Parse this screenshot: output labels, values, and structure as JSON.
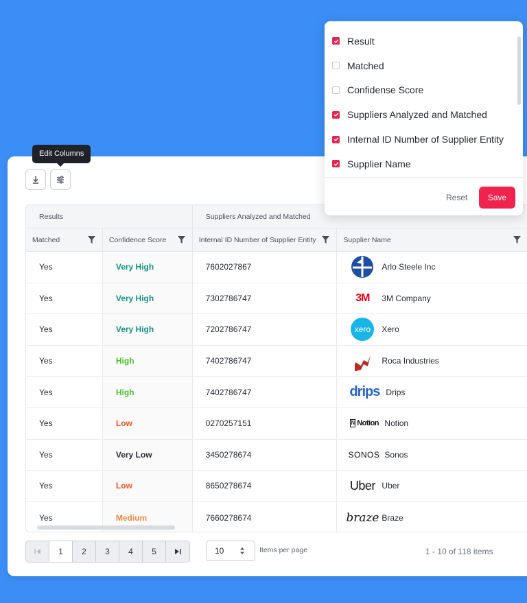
{
  "toolbar": {
    "tooltip": "Edit Columns"
  },
  "table": {
    "groups": [
      "Results",
      "Suppliers Analyzed and Matched"
    ],
    "columns": [
      "Matched",
      "Confidence Score",
      "Internal ID Number of Supplier Entity",
      "Supplier Name"
    ],
    "rows": [
      {
        "matched": "Yes",
        "confidence": "Very High",
        "conf_color": "#12917f",
        "id": "7602027867",
        "supplier": "Arlo Steele Inc",
        "logo": "arlo-steele-logo"
      },
      {
        "matched": "Yes",
        "confidence": "Very High",
        "conf_color": "#12917f",
        "id": "7302786747",
        "supplier": "3M Company",
        "logo": "3m-logo"
      },
      {
        "matched": "Yes",
        "confidence": "Very High",
        "conf_color": "#12917f",
        "id": "7202786747",
        "supplier": "Xero",
        "logo": "xero-logo"
      },
      {
        "matched": "Yes",
        "confidence": "High",
        "conf_color": "#4cc22a",
        "id": "7402786747",
        "supplier": "Roca Industries",
        "logo": "roca-logo"
      },
      {
        "matched": "Yes",
        "confidence": "High",
        "conf_color": "#4cc22a",
        "id": "7402786747",
        "supplier": "Drips",
        "logo": "drips-logo"
      },
      {
        "matched": "Yes",
        "confidence": "Low",
        "conf_color": "#f0541e",
        "id": "0270257151",
        "supplier": "Notion",
        "logo": "notion-logo"
      },
      {
        "matched": "Yes",
        "confidence": "Very Low",
        "conf_color": "#2b2f35",
        "id": "3450278674",
        "supplier": "Sonos",
        "logo": "sonos-logo"
      },
      {
        "matched": "Yes",
        "confidence": "Low",
        "conf_color": "#f0541e",
        "id": "8650278674",
        "supplier": "Uber",
        "logo": "uber-logo"
      },
      {
        "matched": "Yes",
        "confidence": "Medium",
        "conf_color": "#f08a3c",
        "id": "7660278674",
        "supplier": "Braze",
        "logo": "braze-logo"
      }
    ],
    "logo_text": {
      "drips": "drips",
      "notion": "Notion",
      "sonos": "SONOS",
      "uber": "Uber",
      "braze": "braze",
      "xero": "xero",
      "m3": "3M"
    }
  },
  "pagination": {
    "pages": [
      "1",
      "2",
      "3",
      "4",
      "5"
    ],
    "active_page": "1",
    "per_page": "10",
    "per_page_label": "Items per page",
    "count": "1 - 10 of 118 items"
  },
  "column_editor": {
    "options": [
      {
        "label": "Result",
        "checked": true
      },
      {
        "label": "Matched",
        "checked": false
      },
      {
        "label": "Confidense Score",
        "checked": false
      },
      {
        "label": "Suppliers Analyzed and Matched",
        "checked": true
      },
      {
        "label": "Internal ID Number of Supplier Entity",
        "checked": true
      },
      {
        "label": "Supplier Name",
        "checked": true
      }
    ],
    "reset_label": "Reset",
    "save_label": "Save"
  },
  "colors": {
    "background": "#3b8ef5",
    "accent": "#f0234f"
  }
}
